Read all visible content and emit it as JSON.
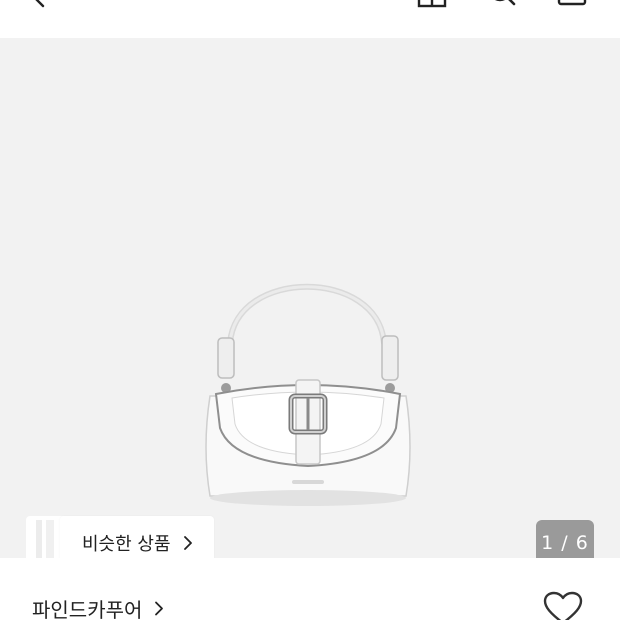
{
  "header": {
    "back_icon": "back-arrow-icon",
    "icons": [
      "store-icon",
      "search-icon",
      "cart-icon"
    ]
  },
  "gallery": {
    "product_image": "white-leather-handbag",
    "similar_label": "비슷한 상품",
    "counter": "1 / 6"
  },
  "product": {
    "brand": "파인드카푸어"
  },
  "colors": {
    "gallery_bg": "#f2f2f2",
    "counter_bg": "#9a9a9a"
  }
}
